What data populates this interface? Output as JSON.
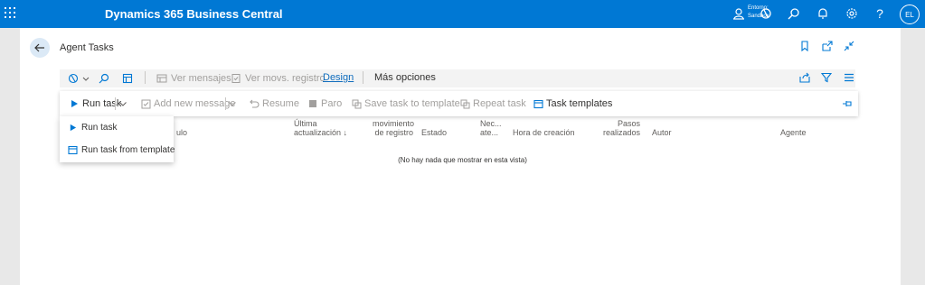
{
  "topbar": {
    "app_title": "Dynamics 365 Business Central",
    "environment_line1": "Entorno:",
    "environment_line2": "Sandbox",
    "avatar_initials": "EL",
    "help_glyph": "?"
  },
  "page": {
    "title": "Agent Tasks"
  },
  "actionbar": {
    "ver_mensajes": "Ver mensajes",
    "ver_movs": "Ver movs. registro",
    "design": "Design",
    "mas_opciones": "Más opciones"
  },
  "taskbar": {
    "run_task": "Run task",
    "add_new_message": "Add new message",
    "resume": "Resume",
    "paro": "Paro",
    "save_task_to_template": "Save task to template",
    "repeat_task": "Repeat task",
    "task_templates": "Task templates"
  },
  "columns": {
    "titulo_fragment": "ulo",
    "ultima_1": "Última",
    "ultima_2": "actualización ↓",
    "movimiento_1": "movimiento",
    "movimiento_2": "de registro",
    "estado": "Estado",
    "nec_1": "Nec...",
    "nec_2": "ate...",
    "hora_creacion": "Hora de creación",
    "pasos_1": "Pasos",
    "pasos_2": "realizados",
    "autor": "Autor",
    "agente": "Agente"
  },
  "empty_message": "(No hay nada que mostrar en esta vista)",
  "dropdown": {
    "items": [
      {
        "label": "Run task"
      },
      {
        "label": "Run task from template"
      }
    ]
  },
  "colors": {
    "brand_blue": "#0078d4",
    "link_blue": "#0f6cbd"
  }
}
